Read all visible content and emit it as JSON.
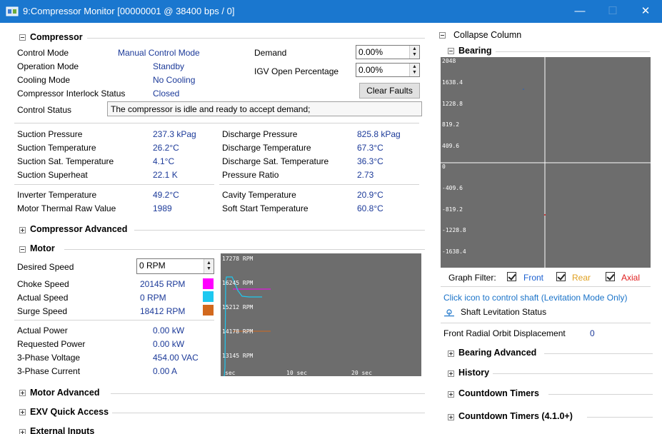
{
  "window": {
    "title": "9:Compressor Monitor [00000001 @ 38400 bps / 0]",
    "minimize": "—",
    "maximize": "☐",
    "close": "✕"
  },
  "compressor": {
    "header": "Compressor",
    "control_mode_label": "Control Mode",
    "control_mode": "Manual Control Mode",
    "operation_mode_label": "Operation Mode",
    "operation_mode": "Standby",
    "cooling_mode_label": "Cooling Mode",
    "cooling_mode": "No Cooling",
    "interlock_label": "Compressor Interlock Status",
    "interlock": "Closed",
    "control_status_label": "Control Status",
    "control_status": "The compressor is idle and ready to accept demand;",
    "demand_label": "Demand",
    "demand": "0.00%",
    "igv_label": "IGV Open Percentage",
    "igv": "0.00%",
    "clear_faults": "Clear Faults",
    "suction_pressure_label": "Suction Pressure",
    "suction_pressure": "237.3 kPag",
    "suction_temp_label": "Suction Temperature",
    "suction_temp": "26.2°C",
    "suction_sat_label": "Suction Sat. Temperature",
    "suction_sat": "4.1°C",
    "suction_superheat_label": "Suction Superheat",
    "suction_superheat": "22.1 K",
    "discharge_pressure_label": "Discharge Pressure",
    "discharge_pressure": "825.8 kPag",
    "discharge_temp_label": "Discharge Temperature",
    "discharge_temp": "67.3°C",
    "discharge_sat_label": "Discharge Sat. Temperature",
    "discharge_sat": "36.3°C",
    "pressure_ratio_label": "Pressure Ratio",
    "pressure_ratio": "2.73",
    "inverter_temp_label": "Inverter Temperature",
    "inverter_temp": "49.2°C",
    "motor_thermal_label": "Motor Thermal Raw Value",
    "motor_thermal": "1989",
    "cavity_temp_label": "Cavity Temperature",
    "cavity_temp": "20.9°C",
    "soft_start_label": "Soft Start Temperature",
    "soft_start": "60.8°C"
  },
  "compressor_advanced": {
    "header": "Compressor Advanced"
  },
  "motor": {
    "header": "Motor",
    "desired_speed_label": "Desired Speed",
    "desired_speed": "0 RPM",
    "choke_speed_label": "Choke Speed",
    "choke_speed": "20145 RPM",
    "choke_color": "#ff00ff",
    "actual_speed_label": "Actual Speed",
    "actual_speed": "0 RPM",
    "actual_color": "#1ec8f0",
    "surge_speed_label": "Surge Speed",
    "surge_speed": "18412 RPM",
    "surge_color": "#d2691e",
    "actual_power_label": "Actual Power",
    "actual_power": "0.00 kW",
    "requested_power_label": "Requested Power",
    "requested_power": "0.00 kW",
    "voltage_label": "3-Phase Voltage",
    "voltage": "454.00 VAC",
    "current_label": "3-Phase Current",
    "current": "0.00 A",
    "graph": {
      "y_ticks": [
        "17278 RPM",
        "16245 RPM",
        "15212 RPM",
        "14178 RPM",
        "13145 RPM"
      ],
      "x_ticks": [
        "sec",
        "10 sec",
        "20 sec"
      ]
    }
  },
  "motor_advanced": {
    "header": "Motor Advanced"
  },
  "exv": {
    "header": "EXV Quick Access"
  },
  "external_inputs": {
    "header": "External Inputs"
  },
  "right": {
    "collapse_column": "Collapse Column",
    "bearing_header": "Bearing",
    "bearing_y_ticks": [
      "2048",
      "1638.4",
      "1228.8",
      "819.2",
      "409.6",
      "0",
      "-409.6",
      "-819.2",
      "-1228.8",
      "-1638.4"
    ],
    "graph_filter_label": "Graph Filter:",
    "filter_front": "Front",
    "filter_rear": "Rear",
    "filter_axial": "Axial",
    "front_color": "#1a5fd0",
    "rear_color": "#e0a020",
    "axial_color": "#e02020",
    "click_icon_text": "Click icon to control shaft (Levitation Mode Only)",
    "shaft_status": "Shaft Levitation Status",
    "orbit_label": "Front Radial Orbit Displacement",
    "orbit_value": "0",
    "bearing_advanced": "Bearing Advanced",
    "history": "History",
    "countdown": "Countdown Timers",
    "countdown_410": "Countdown Timers (4.1.0+)"
  }
}
